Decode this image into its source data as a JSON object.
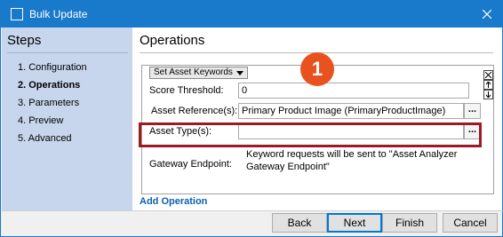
{
  "window": {
    "title": "Bulk Update",
    "accent_color": "#1979ca",
    "icons": {
      "app": "window-icon",
      "close": "close-icon"
    }
  },
  "steps": {
    "title": "Steps",
    "items": [
      {
        "label": "1. Configuration",
        "active": false
      },
      {
        "label": "2. Operations",
        "active": true
      },
      {
        "label": "3. Parameters",
        "active": false
      },
      {
        "label": "4. Preview",
        "active": false
      },
      {
        "label": "5. Advanced",
        "active": false
      }
    ]
  },
  "operations": {
    "title": "Operations",
    "operation_type": "Set Asset Keywords",
    "callout_number": "1",
    "highlight_color": "#9b1b24",
    "callout_color": "#e8521f",
    "fields": {
      "score_threshold": {
        "label": "Score Threshold:",
        "value": "0"
      },
      "asset_reference": {
        "label": "Asset Reference(s):",
        "value": "Primary Product Image (PrimaryProductImage)",
        "button": "..."
      },
      "asset_type": {
        "label": "Asset Type(s):",
        "value": "",
        "button": "..."
      },
      "gateway_endpoint": {
        "label": "Gateway Endpoint:",
        "value": "Keyword requests will be sent to \"Asset Analyzer Gateway Endpoint\""
      }
    },
    "add_operation": "Add Operation"
  },
  "buttons": {
    "back": "Back",
    "next": "Next",
    "finish": "Finish",
    "cancel": "Cancel"
  }
}
